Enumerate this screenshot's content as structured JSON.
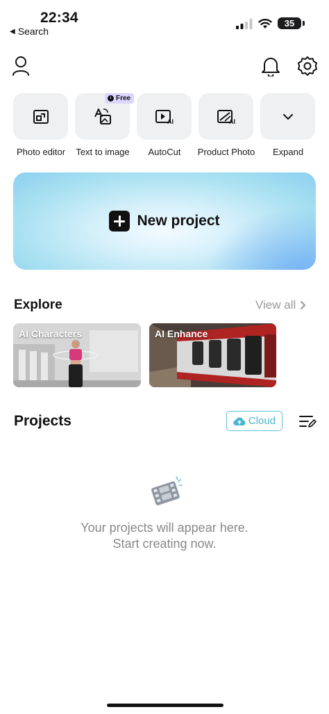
{
  "status_bar": {
    "time": "22:34",
    "back_label": "Search",
    "battery": "35"
  },
  "header": {
    "profile_icon": "person-icon",
    "notification_icon": "bell-icon",
    "settings_icon": "gear-icon"
  },
  "tools": [
    {
      "label": "Photo editor",
      "icon": "photo-editor-icon"
    },
    {
      "label": "Text to image",
      "icon": "text-to-image-icon",
      "badge": "Free"
    },
    {
      "label": "AutoCut",
      "icon": "autocut-icon"
    },
    {
      "label": "Product Photo",
      "icon": "product-photo-icon"
    },
    {
      "label": "Expand",
      "icon": "chevron-down-icon"
    }
  ],
  "new_project": {
    "label": "New project"
  },
  "explore": {
    "title": "Explore",
    "view_all": "View all",
    "cards": [
      {
        "label": "AI Characters"
      },
      {
        "label": "AI Enhance"
      }
    ]
  },
  "projects": {
    "title": "Projects",
    "cloud_label": "Cloud",
    "empty_line1": "Your projects will appear here.",
    "empty_line2": "Start creating now."
  },
  "colors": {
    "accent_cyan": "#49b6cf",
    "free_badge": "#dcd5ff",
    "tile_bg": "#eef0f2"
  }
}
